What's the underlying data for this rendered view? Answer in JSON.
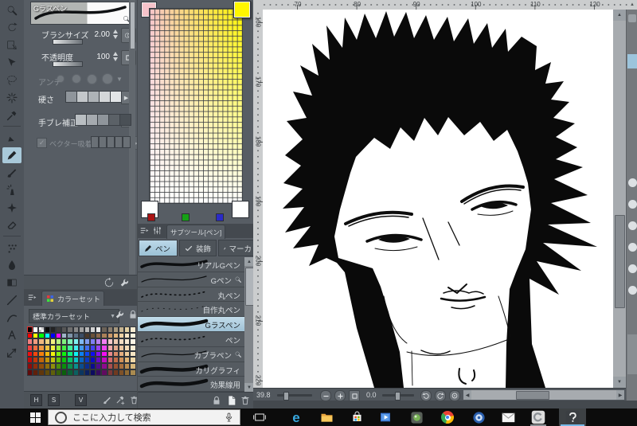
{
  "toolbar": {
    "tools": [
      {
        "name": "zoom",
        "icon": "magnifier",
        "selected": false
      },
      {
        "name": "rotate",
        "icon": "rotate",
        "selected": false
      },
      {
        "name": "move-layer",
        "icon": "move",
        "selected": false
      },
      {
        "name": "object",
        "icon": "object",
        "selected": false
      },
      {
        "name": "selection-lasso",
        "icon": "lasso",
        "selected": false
      },
      {
        "name": "auto-select",
        "icon": "wand",
        "selected": false
      },
      {
        "name": "eyedropper",
        "icon": "dropper",
        "selected": false
      },
      {
        "name": "pen",
        "icon": "pen",
        "selected": false
      },
      {
        "name": "pencil",
        "icon": "pencil",
        "selected": true
      },
      {
        "name": "brush",
        "icon": "brush",
        "selected": false
      },
      {
        "name": "airbrush",
        "icon": "airbrush",
        "selected": false
      },
      {
        "name": "decoration",
        "icon": "decoration",
        "selected": false
      },
      {
        "name": "eraser",
        "icon": "eraser",
        "selected": false
      },
      {
        "name": "blend",
        "icon": "blend",
        "selected": false
      },
      {
        "name": "fill",
        "icon": "fill",
        "selected": false
      },
      {
        "name": "gradient",
        "icon": "gradient",
        "selected": false
      },
      {
        "name": "figure",
        "icon": "line",
        "selected": false
      },
      {
        "name": "frame",
        "icon": "curve",
        "selected": false
      },
      {
        "name": "text",
        "icon": "text",
        "selected": false
      },
      {
        "name": "ruler",
        "icon": "ruler",
        "selected": false
      }
    ]
  },
  "tool_property": {
    "tool_name": "Gラスペン",
    "rows": {
      "brush_size": {
        "label": "ブラシサイズ",
        "value": "2.00"
      },
      "opacity": {
        "label": "不透明度",
        "value": "100"
      },
      "anti_aliasing": {
        "label": "アンチ"
      },
      "hardness": {
        "label": "硬さ",
        "swatches": [
          "#8f959b",
          "#c3c7ca",
          "#aeb3b7",
          "#d4d7d9",
          "#e2e5e7"
        ]
      },
      "stabilization": {
        "label": "手ブレ補正",
        "swatches": [
          "#b9bec2",
          "#a5aaaf",
          "#8f959b",
          "#5b6167",
          "#4a5056"
        ]
      },
      "vector_snap": {
        "label": "ベクター吸着",
        "swatches": [
          "#6a7076",
          "#6a7076",
          "#6a7076",
          "#6a7076",
          "#6a7076"
        ]
      }
    }
  },
  "gradient_palette": {
    "top_left": "#f6c3ca",
    "top_right": "#fff600",
    "bottom_left": "#ffffff",
    "bottom_right": "#ffffff",
    "rgb_swatches": [
      "#aa1414",
      "#16a016",
      "#2a2ac8"
    ]
  },
  "subtool": {
    "header_title": "サブツール[ペン]",
    "tabs": [
      {
        "label": "ペン",
        "icon": "pencil",
        "selected": true
      },
      {
        "label": "装飾",
        "icon": "check",
        "selected": false
      },
      {
        "label": "マーカ",
        "icon": "marker",
        "selected": false
      }
    ],
    "brushes": [
      {
        "name": "リアルGペン",
        "stroke": "taper",
        "zoom_icon": false,
        "selected": false
      },
      {
        "name": "Gペン",
        "stroke": "thin",
        "zoom_icon": true,
        "selected": false
      },
      {
        "name": "丸ペン",
        "stroke": "dots",
        "zoom_icon": false,
        "selected": false
      },
      {
        "name": "自作丸ペン",
        "stroke": "faintdots",
        "zoom_icon": false,
        "selected": false
      },
      {
        "name": "Gラスペン",
        "stroke": "thick",
        "zoom_icon": false,
        "selected": true
      },
      {
        "name": "ペン",
        "stroke": "dots",
        "zoom_icon": false,
        "selected": false
      },
      {
        "name": "カブラペン",
        "stroke": "thin",
        "zoom_icon": true,
        "selected": false
      },
      {
        "name": "カリグラフィ",
        "stroke": "thick",
        "zoom_icon": false,
        "selected": false
      },
      {
        "name": "効果線用",
        "stroke": "thick",
        "zoom_icon": false,
        "selected": false
      }
    ]
  },
  "color_set": {
    "tab_label": "カラーセット",
    "preset_name": "標準カラーセット",
    "hsv_buttons": [
      "H",
      "S",
      "V"
    ],
    "selected_cell": [
      0,
      0
    ],
    "grid": [
      [
        "#000000",
        "#ffffff",
        "checker",
        "#0a0a0a",
        "#232323",
        "#3c3c3c",
        "#555555",
        "#6e6e6e",
        "#878787",
        "#a0a0a0",
        "#b9b9b9",
        "#d2d2d2",
        "#ebebeb",
        "#6b6258",
        "#8a7d6d",
        "#a8997f",
        "#c6b491",
        "#e3d0a3",
        "#f7ecd2"
      ],
      [
        "#ff0000",
        "#ffff00",
        "#00ff00",
        "#00ffff",
        "#0000ff",
        "#ff00ff",
        "#9fb6c9",
        "#7e93a8",
        "#5d7086",
        "#3c4d64",
        "#4a3828",
        "#6a5038",
        "#8a6848",
        "#aa8058",
        "#ca9868",
        "#e0b47c",
        "#edd0a4",
        "#f5e4c4",
        "#fbf2dd"
      ],
      [
        "#F17F7F",
        "#F19B7F",
        "#F1B87F",
        "#F1D47F",
        "#F1F17F",
        "#B8F17F",
        "#7FF17F",
        "#7FF1B8",
        "#7FF1F1",
        "#7FB8F1",
        "#7F9BF1",
        "#7F7FF1",
        "#B87FF1",
        "#F17FF1",
        "#F6C9C9",
        "#EEC9B1",
        "#F3DCC3",
        "#F9E9D4",
        "#FDF5E6"
      ],
      [
        "#F04242",
        "#F06E42",
        "#F09942",
        "#F0C442",
        "#F0F042",
        "#99F042",
        "#42F042",
        "#42F099",
        "#42F0F0",
        "#4299F0",
        "#426EF0",
        "#4242F0",
        "#9942F0",
        "#F042F0",
        "#EFA9A9",
        "#E3A98C",
        "#ECC5A0",
        "#F4DBB8",
        "#FBEED6"
      ],
      [
        "#F20D0D",
        "#F2460D",
        "#F2800D",
        "#F2B90D",
        "#F2F20D",
        "#80F20D",
        "#0DF20D",
        "#0DF280",
        "#0DF2F2",
        "#0D80F2",
        "#0D46F2",
        "#0D0DF2",
        "#800DF2",
        "#F20DF2",
        "#E88A8A",
        "#D98A68",
        "#E4AD7E",
        "#EFCC9C",
        "#F8E6C5"
      ],
      [
        "#C20A0A",
        "#C2380A",
        "#C2660A",
        "#C2940A",
        "#C2C20A",
        "#66C20A",
        "#0AC20A",
        "#0AC266",
        "#0AC2C2",
        "#0A66C2",
        "#0A38C2",
        "#0A0AC2",
        "#660AC2",
        "#C20AC2",
        "#D16A6A",
        "#C06C48",
        "#CF9058",
        "#E0B476",
        "#F0D8A8"
      ],
      [
        "#8E0B0B",
        "#8E2C0B",
        "#8E4D0B",
        "#8E6E0B",
        "#8E8E0B",
        "#4D8E0B",
        "#0B8E0B",
        "#0B8E4D",
        "#0B8E8E",
        "#0B4D8E",
        "#0B2C8E",
        "#0B0B8E",
        "#4D0B8E",
        "#8E0B8E",
        "#A84F4F",
        "#985232",
        "#A86F3E",
        "#BC8F52",
        "#D8B87C"
      ],
      [
        "#600B0B",
        "#60200B",
        "#60360B",
        "#604B0B",
        "#60600B",
        "#36600B",
        "#0B600B",
        "#0B6036",
        "#0B6060",
        "#0B3660",
        "#0B2060",
        "#0B0B60",
        "#360B60",
        "#600B60",
        "#7C3838",
        "#703A20",
        "#7E5128",
        "#8F6A34",
        "#A98A50"
      ]
    ]
  },
  "canvas": {
    "ruler_top_labels": [
      "70",
      "80",
      "90",
      "100",
      "110",
      "120"
    ],
    "ruler_left_labels": [
      "160",
      "170",
      "180",
      "190",
      "200",
      "210",
      "220"
    ],
    "zoom_value": "39.8",
    "rotation_value": "0.0"
  },
  "taskbar": {
    "search_placeholder": "ここに入力して検索",
    "icons": [
      {
        "name": "task-view",
        "running": false,
        "active": false
      },
      {
        "name": "edge",
        "running": false,
        "active": false
      },
      {
        "name": "file-explorer",
        "running": false,
        "active": false
      },
      {
        "name": "store",
        "running": false,
        "active": false
      },
      {
        "name": "movies-tv",
        "running": false,
        "active": false
      },
      {
        "name": "app-green",
        "running": false,
        "active": false
      },
      {
        "name": "chrome",
        "running": false,
        "active": false
      },
      {
        "name": "app-disc",
        "running": false,
        "active": false
      },
      {
        "name": "mail",
        "running": false,
        "active": false
      },
      {
        "name": "clip-studio",
        "running": true,
        "active": false
      },
      {
        "name": "clip-studio-paint",
        "running": true,
        "active": true
      }
    ]
  }
}
